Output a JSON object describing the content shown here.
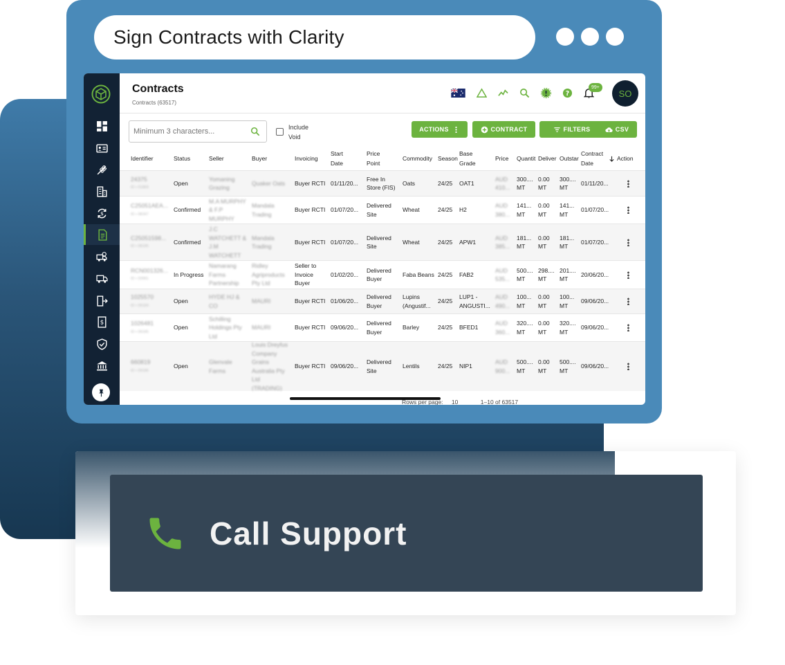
{
  "window": {
    "title": "Sign Contracts with Clarity"
  },
  "header": {
    "title": "Contracts",
    "subtitle": "Contracts (63517)",
    "notification_count": "99+",
    "avatar_initials": "SO"
  },
  "toolbar": {
    "search_placeholder": "Minimum 3 characters...",
    "include_void_label": "Include Void",
    "actions_label": "ACTIONS",
    "contract_label": "CONTRACT",
    "filters_label": "FILTERS",
    "csv_label": "CSV"
  },
  "table": {
    "headers": [
      "Identifier",
      "Status",
      "Seller",
      "Buyer",
      "Invoicing",
      "Start Date",
      "Price Point",
      "Commodity",
      "Season",
      "Base Grade",
      "Price",
      "Quantit",
      "Deliver",
      "Outstar",
      "Contract Date",
      "Action"
    ],
    "rows": [
      {
        "id": "24375",
        "id_sub": "ID • 01869",
        "status": "Open",
        "seller": "Yomaning Grazing",
        "buyer": "Quaker Oats",
        "invoicing": "Buyer RCTI",
        "start": "01/11/20...",
        "price_point": "Free In Store (FIS)",
        "commodity": "Oats",
        "season": "24/25",
        "grade": "OAT1",
        "price": "AUD 410...",
        "qty": "300.... MT",
        "delivered": "0.00 MT",
        "outstanding": "300.... MT",
        "date": "01/11/20..."
      },
      {
        "id": "C25051AEA...",
        "id_sub": "ID • 08347",
        "status": "Confirmed",
        "seller": "M.A MURPHY & F.P MURPHY",
        "buyer": "Mandala Trading",
        "invoicing": "Buyer RCTI",
        "start": "01/07/20...",
        "price_point": "Delivered Site",
        "commodity": "Wheat",
        "season": "24/25",
        "grade": "H2",
        "price": "AUD 380...",
        "qty": "141... MT",
        "delivered": "0.00 MT",
        "outstanding": "141... MT",
        "date": "01/07/20..."
      },
      {
        "id": "C25051598...",
        "id_sub": "ID • 08185",
        "status": "Confirmed",
        "seller": "J.C WATCHETT & J.M WATCHETT",
        "buyer": "Mandala Trading",
        "invoicing": "Buyer RCTI",
        "start": "01/07/20...",
        "price_point": "Delivered Site",
        "commodity": "Wheat",
        "season": "24/25",
        "grade": "APW1",
        "price": "AUD 385...",
        "qty": "181... MT",
        "delivered": "0.00 MT",
        "outstanding": "181... MT",
        "date": "01/07/20..."
      },
      {
        "id": "RCN001326...",
        "id_sub": "ID • 03991",
        "status": "In Progress",
        "seller": "Namarang Farms Partnership",
        "buyer": "Ridley Agriproducts Pty Ltd",
        "invoicing": "Seller to Invoice Buyer",
        "start": "01/02/20...",
        "price_point": "Delivered Buyer",
        "commodity": "Faba Beans",
        "season": "24/25",
        "grade": "FAB2",
        "price": "AUD 535...",
        "qty": "500.... MT",
        "delivered": "298.... MT",
        "outstanding": "201.... MT",
        "date": "20/06/20..."
      },
      {
        "id": "1025570",
        "id_sub": "ID • 09184",
        "status": "Open",
        "seller": "HYDE HJ & CO",
        "buyer": "MAURI",
        "invoicing": "Buyer RCTI",
        "start": "01/06/20...",
        "price_point": "Delivered Buyer",
        "commodity": "Lupins (Angustif...",
        "season": "24/25",
        "grade": "LUP1 - ANGUSTI...",
        "price": "AUD 490...",
        "qty": "100... MT",
        "delivered": "0.00 MT",
        "outstanding": "100... MT",
        "date": "09/06/20..."
      },
      {
        "id": "1026481",
        "id_sub": "ID • 09185",
        "status": "Open",
        "seller": "Schilling Holdings Pty Ltd",
        "buyer": "MAURI",
        "invoicing": "Buyer RCTI",
        "start": "09/06/20...",
        "price_point": "Delivered Buyer",
        "commodity": "Barley",
        "season": "24/25",
        "grade": "BFED1",
        "price": "AUD 360...",
        "qty": "320.... MT",
        "delivered": "0.00 MT",
        "outstanding": "320.... MT",
        "date": "09/06/20..."
      },
      {
        "id": "660819",
        "id_sub": "ID • 09186",
        "status": "Open",
        "seller": "Glenvale Farms",
        "buyer": "Louis Dreyfus Company Grains Australia Pty Ltd (TRADING)",
        "invoicing": "Buyer RCTI",
        "start": "09/06/20...",
        "price_point": "Delivered Site",
        "commodity": "Lentils",
        "season": "24/25",
        "grade": "NIP1",
        "price": "AUD 900...",
        "qty": "500.... MT",
        "delivered": "0.00 MT",
        "outstanding": "500.... MT",
        "date": "09/06/20..."
      }
    ]
  },
  "pagination": {
    "rows_per_page_label": "Rows per page:",
    "rows_per_page": "10",
    "range": "1–10 of 63517"
  },
  "support": {
    "label": "Call Support"
  },
  "colors": {
    "accent": "#6cb33f",
    "sidebar": "#122234",
    "frame": "#4a8ab9",
    "support_bg": "#344555"
  },
  "icons": [
    "dashboard-icon",
    "contact-card-icon",
    "wheat-icon",
    "buildings-icon",
    "currency-exchange-icon",
    "document-icon",
    "truck-search-icon",
    "truck-icon",
    "exit-icon",
    "invoice-icon",
    "shield-check-icon",
    "bank-icon",
    "pin-icon",
    "flag-au-icon",
    "warning-icon",
    "trend-icon",
    "search-icon",
    "settings-badge-icon",
    "help-icon",
    "bell-icon",
    "phone-icon"
  ]
}
